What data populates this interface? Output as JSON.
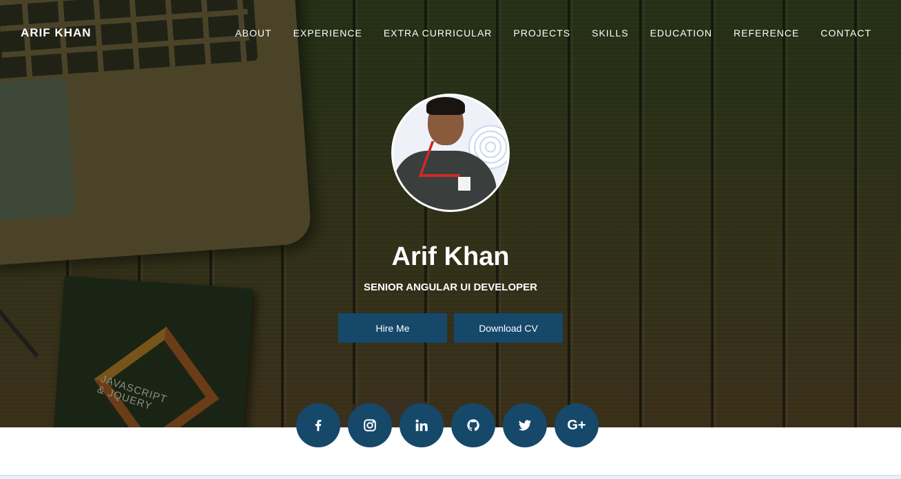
{
  "brand": {
    "name": "ARIF KHAN"
  },
  "nav": {
    "items": [
      {
        "label": "ABOUT"
      },
      {
        "label": "EXPERIENCE"
      },
      {
        "label": "EXTRA CURRICULAR"
      },
      {
        "label": "PROJECTS"
      },
      {
        "label": "SKILLS"
      },
      {
        "label": "EDUCATION"
      },
      {
        "label": "REFERENCE"
      },
      {
        "label": "CONTACT"
      }
    ]
  },
  "hero": {
    "name": "Arif Khan",
    "subtitle": "SENIOR ANGULAR UI DEVELOPER",
    "hire_label": "Hire Me",
    "cv_label": "Download CV",
    "book_title_line1": "JAVASCRIPT",
    "book_title_line2": "& JQUERY"
  },
  "social": {
    "items": [
      {
        "icon": "facebook-icon"
      },
      {
        "icon": "instagram-icon"
      },
      {
        "icon": "linkedin-icon"
      },
      {
        "icon": "github-icon"
      },
      {
        "icon": "twitter-icon"
      },
      {
        "icon": "google-plus-icon",
        "text": "G+"
      }
    ]
  },
  "colors": {
    "accent": "#16486a",
    "text": "#ffffff"
  }
}
